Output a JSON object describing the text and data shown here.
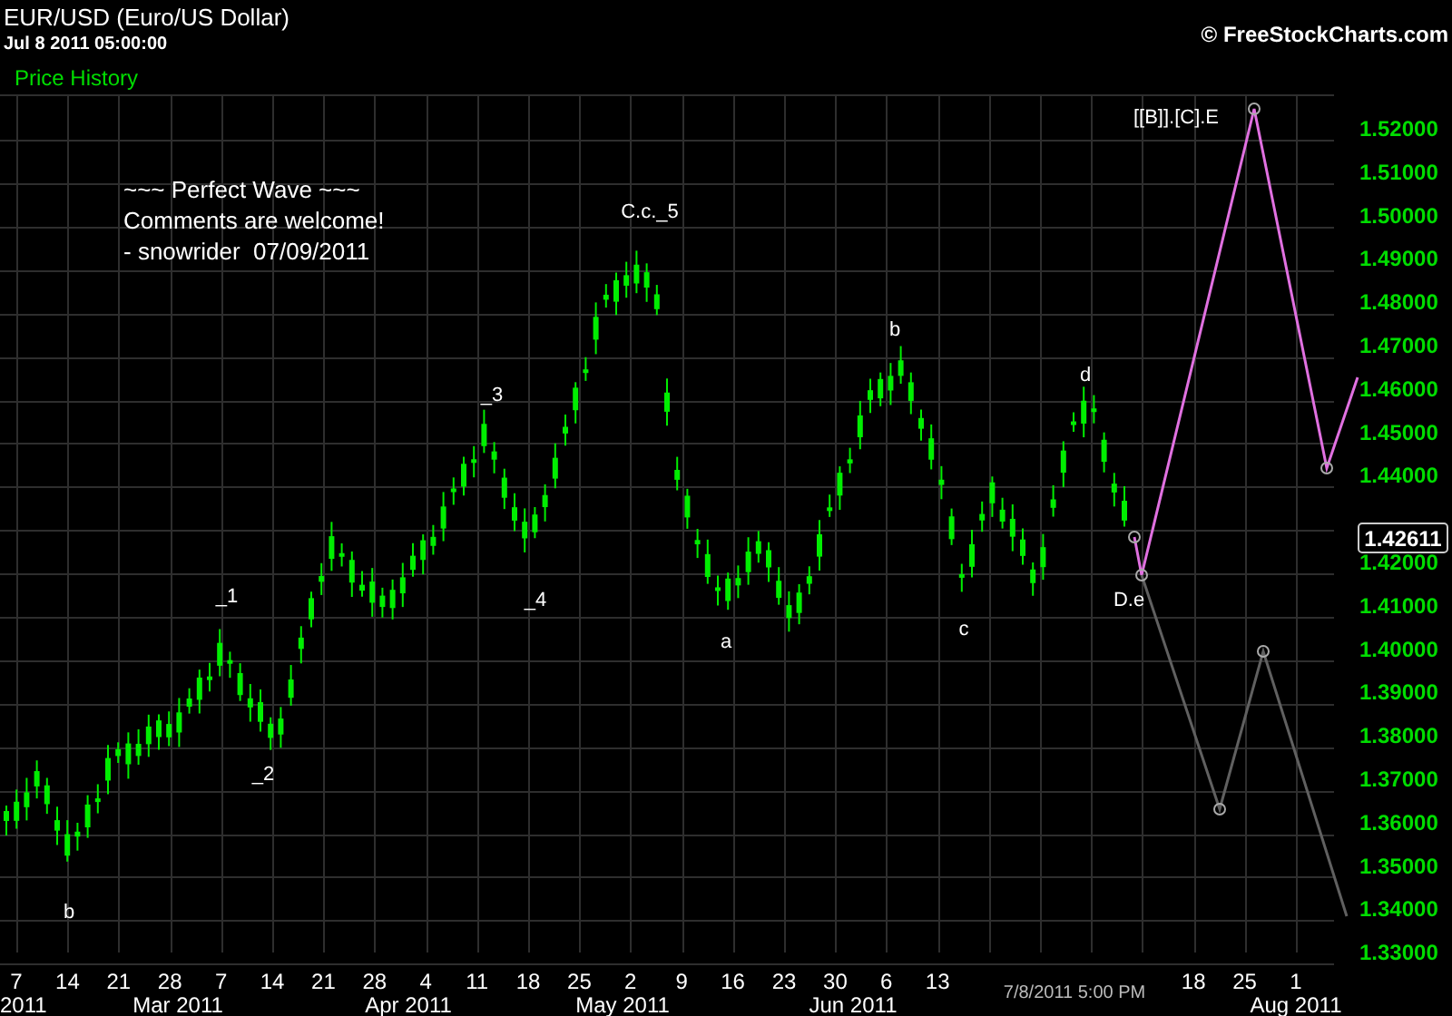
{
  "header": {
    "title": "EUR/USD (Euro/US Dollar)",
    "timestamp": "Jul 8 2011 05:00:00",
    "panel": "Price History",
    "copyright": "© FreeStockCharts.com"
  },
  "note": [
    "~~~ Perfect Wave ~~~",
    "Comments are welcome!",
    "- snowrider  07/09/2011"
  ],
  "wave_labels": [
    {
      "text": "b"
    },
    {
      "text": "_1"
    },
    {
      "text": "_2"
    },
    {
      "text": "_3"
    },
    {
      "text": "_4"
    },
    {
      "text": "C.c._5"
    },
    {
      "text": "a"
    },
    {
      "text": "b"
    },
    {
      "text": "c"
    },
    {
      "text": "d"
    },
    {
      "text": "D.e"
    },
    {
      "text": "[[B]].[C].E"
    }
  ],
  "projections": [
    {
      "color": "#e070e0"
    },
    {
      "color": "#606060"
    }
  ],
  "y_axis": {
    "ticks_upper": [
      "1.52000",
      "1.51000",
      "1.50000",
      "1.49000",
      "1.48000",
      "1.47000",
      "1.46000",
      "1.45000",
      "1.44000"
    ],
    "ticks_lower": [
      "1.42000",
      "1.41000",
      "1.40000",
      "1.39000",
      "1.38000",
      "1.37000",
      "1.36000",
      "1.35000",
      "1.34000",
      "1.33000"
    ],
    "last_price": "1.42611"
  },
  "x_axis": {
    "days": [
      "7",
      "14",
      "21",
      "28",
      "7",
      "14",
      "21",
      "28",
      "4",
      "11",
      "18",
      "25",
      "2",
      "9",
      "16",
      "23",
      "30",
      "6",
      "13",
      "18",
      "25",
      "1"
    ],
    "months": [
      "2011",
      "Mar 2011",
      "Apr 2011",
      "May 2011",
      "Jun 2011",
      "Aug 2011"
    ],
    "cursor": "7/8/2011 5:00 PM"
  }
}
